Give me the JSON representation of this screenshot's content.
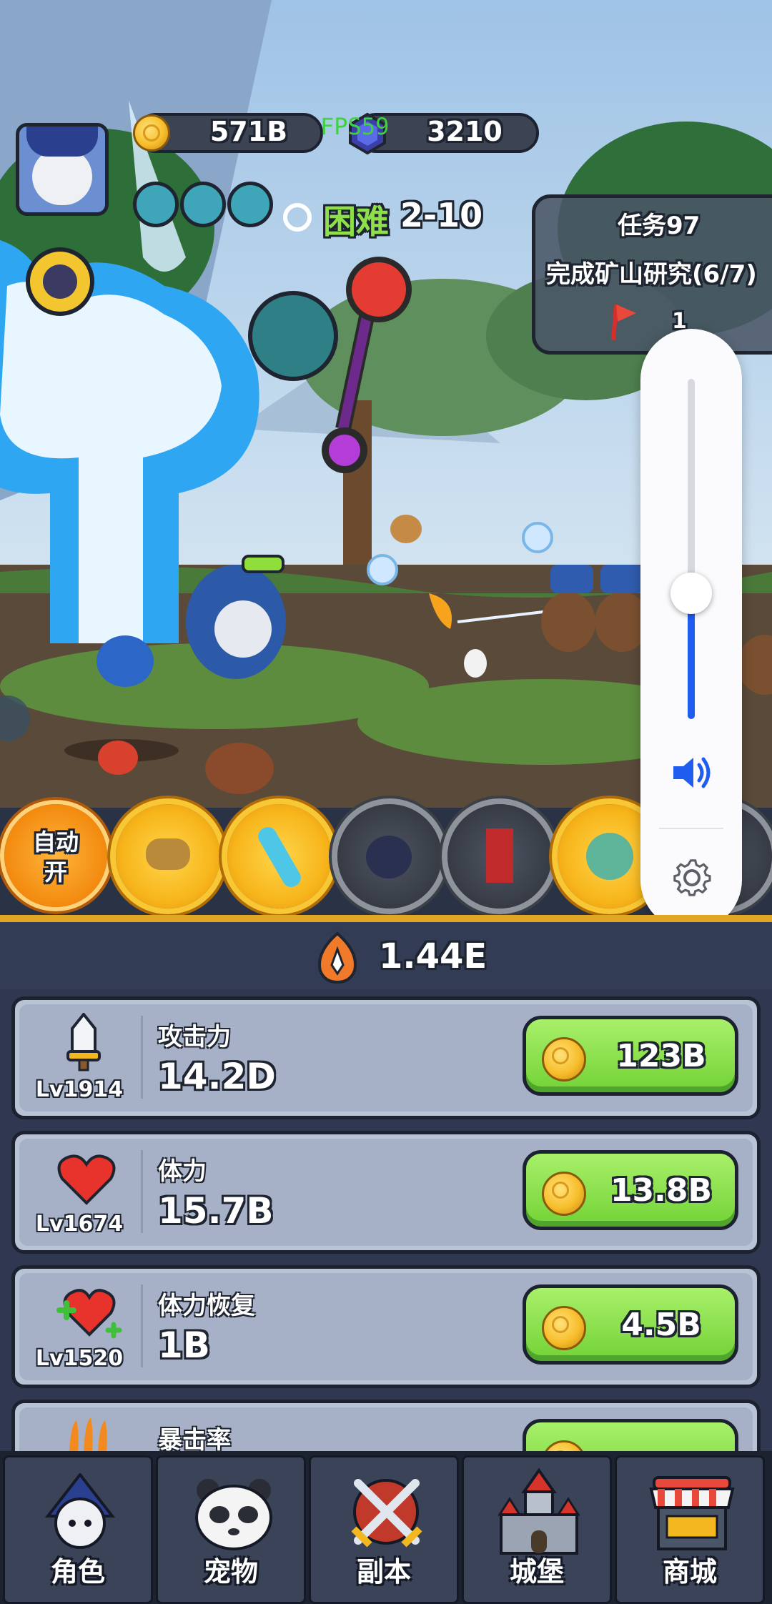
{
  "hud": {
    "gold": "571B",
    "fps": "FPS59",
    "gems": "3210",
    "difficulty": "困难",
    "stage": "2-10"
  },
  "quest": {
    "title": "任务97",
    "desc": "完成矿山研究(6/7)",
    "reward": "1"
  },
  "skills": {
    "auto_label_1": "自动",
    "auto_label_2": "开"
  },
  "power": {
    "value": "1.44E"
  },
  "stats": [
    {
      "level": "Lv1914",
      "name": "攻击力",
      "value": "14.2D",
      "cost": "123B"
    },
    {
      "level": "Lv1674",
      "name": "体力",
      "value": "15.7B",
      "cost": "13.8B"
    },
    {
      "level": "Lv1520",
      "name": "体力恢复",
      "value": "1B",
      "cost": "4.5B"
    },
    {
      "level": "",
      "name": "暴击率",
      "value": "",
      "cost": ""
    }
  ],
  "volume": {
    "level": 0.37
  },
  "nav": [
    "角色",
    "宠物",
    "副本",
    "城堡",
    "商城"
  ],
  "colors": {
    "accent_green": "#7bd63b",
    "panel": "#2f3850",
    "volume_blue": "#1f5cf0"
  }
}
